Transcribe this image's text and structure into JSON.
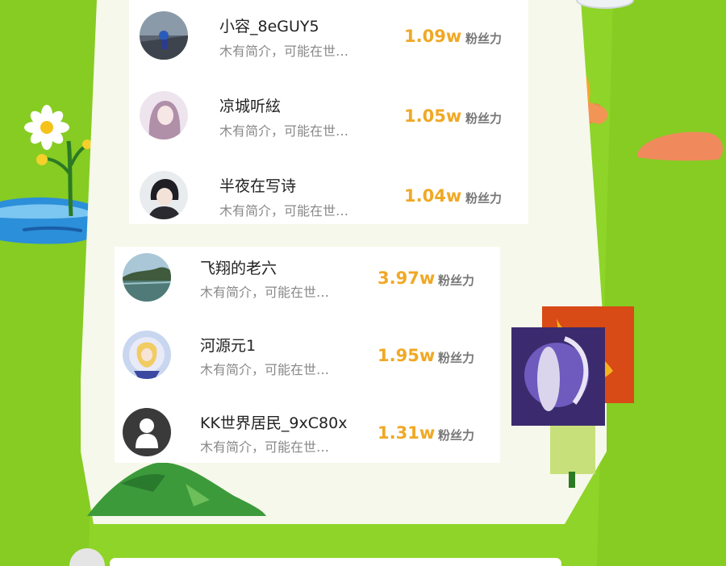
{
  "leaderboard": {
    "top_group": [
      {
        "name": "小容_8eGUY5",
        "bio": "木有简介，可能在世…",
        "fans_value": "1.09w",
        "fans_unit": "粉丝力"
      },
      {
        "name": "凉城听絃",
        "bio": "木有简介，可能在世…",
        "fans_value": "1.05w",
        "fans_unit": "粉丝力"
      },
      {
        "name": "半夜在写诗",
        "bio": "木有简介，可能在世…",
        "fans_value": "1.04w",
        "fans_unit": "粉丝力"
      }
    ],
    "bottom_group": [
      {
        "name": "飞翔的老六",
        "bio": "木有简介，可能在世…",
        "fans_value": "3.97w",
        "fans_unit": "粉丝力"
      },
      {
        "name": "河源元1",
        "bio": "木有简介，可能在世…",
        "fans_value": "1.95w",
        "fans_unit": "粉丝力"
      },
      {
        "name": "KK世界居民_9xC80x",
        "bio": "木有简介，可能在世…",
        "fans_value": "1.31w",
        "fans_unit": "粉丝力"
      }
    ]
  },
  "colors": {
    "background": "#8fd428",
    "accent_orange": "#f0a825",
    "card": "#ffffff"
  }
}
